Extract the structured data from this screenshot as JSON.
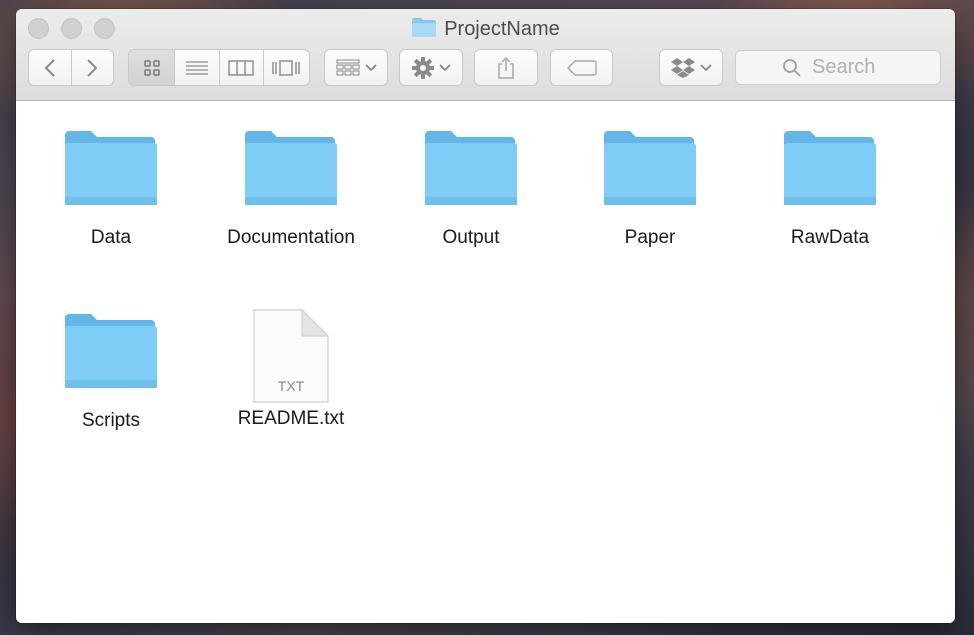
{
  "window": {
    "title": "ProjectName"
  },
  "search": {
    "placeholder": "Search"
  },
  "items": [
    {
      "name": "Data",
      "kind": "folder"
    },
    {
      "name": "Documentation",
      "kind": "folder"
    },
    {
      "name": "Output",
      "kind": "folder"
    },
    {
      "name": "Paper",
      "kind": "folder"
    },
    {
      "name": "RawData",
      "kind": "folder"
    },
    {
      "name": "Scripts",
      "kind": "folder"
    },
    {
      "name": "README.txt",
      "kind": "document",
      "badge": "TXT"
    }
  ],
  "colors": {
    "folder": "#7fcdf6",
    "folder_dark": "#63b7e8",
    "accent": "#7fcdf6"
  }
}
